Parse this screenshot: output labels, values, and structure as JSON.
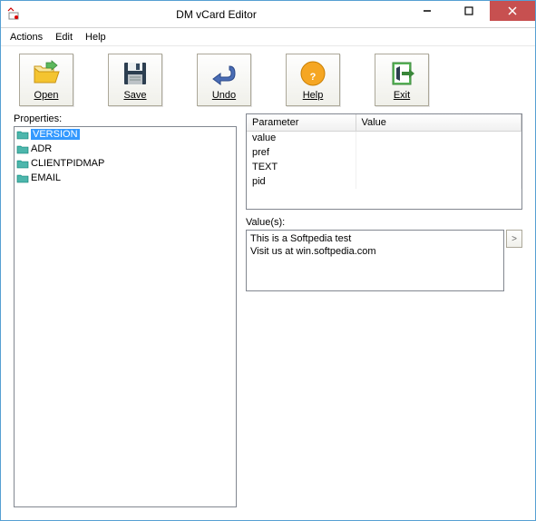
{
  "window": {
    "title": "DM vCard Editor"
  },
  "menubar": {
    "actions": "Actions",
    "edit": "Edit",
    "help": "Help"
  },
  "toolbar": {
    "open": "Open",
    "save": "Save",
    "undo": "Undo",
    "help": "Help",
    "exit": "Exit"
  },
  "properties": {
    "label": "Properties:",
    "items": [
      {
        "label": "VERSION",
        "selected": true
      },
      {
        "label": "ADR",
        "selected": false
      },
      {
        "label": "CLIENTPIDMAP",
        "selected": false
      },
      {
        "label": "EMAIL",
        "selected": false
      }
    ]
  },
  "table": {
    "columns": {
      "parameter": "Parameter",
      "value": "Value"
    },
    "rows": [
      {
        "parameter": "value",
        "value": ""
      },
      {
        "parameter": "pref",
        "value": ""
      },
      {
        "parameter": "TEXT",
        "value": ""
      },
      {
        "parameter": "pid",
        "value": ""
      }
    ]
  },
  "values": {
    "label": "Value(s):",
    "text": "This is a Softpedia test\nVisit us at win.softpedia.com",
    "expand": ">"
  }
}
